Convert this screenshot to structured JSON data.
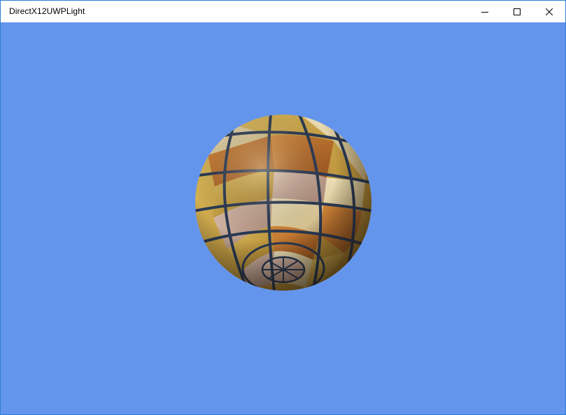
{
  "window": {
    "title": "DirectX12UWPLight"
  },
  "caption_buttons": {
    "minimize_icon": "minimize-icon",
    "maximize_icon": "maximize-icon",
    "close_icon": "close-icon"
  },
  "viewport": {
    "background_color": "#6495ed",
    "object": "textured-sphere"
  },
  "colors": {
    "window_border": "#2b7fd6",
    "tile_gold": "#c9a040",
    "tile_orange": "#b86a28",
    "tile_cream": "#e8d8a8",
    "tile_pink": "#c8a898",
    "grout": "#2a3a55"
  }
}
